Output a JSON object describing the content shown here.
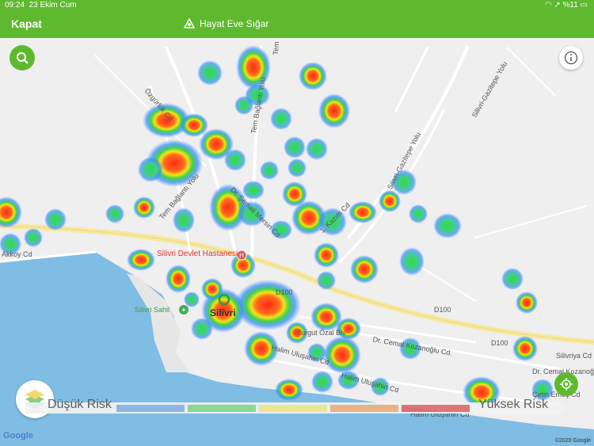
{
  "status_bar": {
    "time": "09:24",
    "date": "23 Ekim Cum",
    "battery": "%11"
  },
  "header": {
    "close_label": "Kapat",
    "brand_label": "Hayat Eve Sığar"
  },
  "map": {
    "labels": {
      "hospital": "Silivri Devlet Hastanesi",
      "town": "Silivri",
      "beach": "Silivri Sahil",
      "road_d100_a": "D100",
      "road_d100_b": "D100",
      "road_d100_c": "D100",
      "road_turgut": "Turgut Özal Blv",
      "road_kozanoglu_a": "Dr. Cemal Kozanoğlu Cd.",
      "road_kozanoglu_b": "Dr. Cemal Kozanoğlu Cd.",
      "road_silivriya": "Silivriya Cd",
      "road_halim_a": "Halim Uluşahin Cd",
      "road_halim_b": "Halim Uluşahin Cd",
      "road_halim_c": "Halim Uluşahin Cd",
      "road_cetin": "Çetin Emeç Cd",
      "road_gazitepe_a": "Silivri-Gazitepe Yolu",
      "road_gazitepe_b": "Silivri-Gazitepe Yolu",
      "road_ozgurluk": "Özgürlük Cd.",
      "road_tem_a": "Tem Bağlantı Yolu",
      "road_tem_b": "Tem Bağlantı Yolu",
      "road_tem_c": "Tem",
      "road_semali": "Dr. Şemali Mersin Cd",
      "road_kazim": "1. Kazım Cd",
      "road_akkoy": "Akkoy Cd"
    },
    "google_label": "Google",
    "copyright": "©2020 Google"
  },
  "legend": {
    "low_label": "Düşük Risk",
    "high_label": "Yüksek Risk",
    "colors": [
      "#8fb6e6",
      "#8bdb8e",
      "#f5e98a",
      "#f2b27e",
      "#e06a6a"
    ]
  },
  "icons": [
    "search-icon",
    "info-icon",
    "layers-icon",
    "locate-icon",
    "hospital-icon",
    "beach-icon",
    "location-pin-icon",
    "wifi-icon",
    "battery-icon",
    "logo-icon"
  ]
}
